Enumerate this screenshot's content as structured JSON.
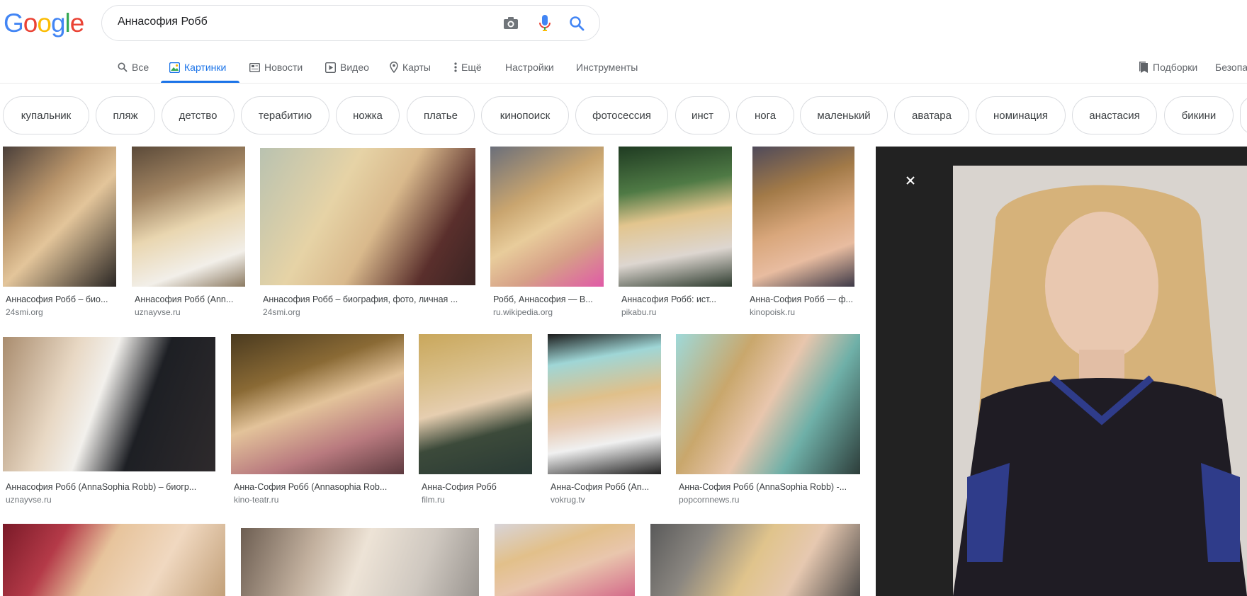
{
  "logo": {
    "letters": [
      "G",
      "o",
      "o",
      "g",
      "l",
      "e"
    ],
    "colors": [
      "#4285F4",
      "#EA4335",
      "#FBBC05",
      "#4285F4",
      "#34A853",
      "#EA4335"
    ]
  },
  "search": {
    "query": "Аннасофия Робб"
  },
  "tabs": {
    "all": "Все",
    "images": "Картинки",
    "news": "Новости",
    "video": "Видео",
    "maps": "Карты",
    "more": "Ещё",
    "settings": "Настройки",
    "tools": "Инструменты",
    "collections": "Подборки",
    "safe": "Безопа"
  },
  "chips": [
    "купальник",
    "пляж",
    "детство",
    "терабитию",
    "ножка",
    "платье",
    "кинопоиск",
    "фотосессия",
    "инст",
    "нога",
    "маленький",
    "аватара",
    "номинация",
    "анастасия",
    "бикини"
  ],
  "results": [
    {
      "title": "Аннасофия Робб – био...",
      "source": "24smi.org"
    },
    {
      "title": "Аннасофия Робб (Ann...",
      "source": "uznayvse.ru"
    },
    {
      "title": "Аннасофия Робб – биография, фото, личная ...",
      "source": "24smi.org"
    },
    {
      "title": "Робб, Аннасофия — В...",
      "source": "ru.wikipedia.org"
    },
    {
      "title": "Аннасофия Робб: ист...",
      "source": "pikabu.ru"
    },
    {
      "title": "Анна-София Робб — ф...",
      "source": "kinopoisk.ru"
    },
    {
      "title": "Аннасофия Робб (AnnaSophia Robb) – биогр...",
      "source": "uznayvse.ru"
    },
    {
      "title": "Анна-София Робб (Annasophia Rob...",
      "source": "kino-teatr.ru"
    },
    {
      "title": "Анна-София Робб",
      "source": "film.ru"
    },
    {
      "title": "Анна-София Робб (An...",
      "source": "vokrug.tv"
    },
    {
      "title": "Анна-София Робб (AnnaSophia Robb) -...",
      "source": "popcornnews.ru"
    }
  ],
  "colors": {
    "accent": "#1a73e8",
    "panel_bg": "#222222"
  }
}
